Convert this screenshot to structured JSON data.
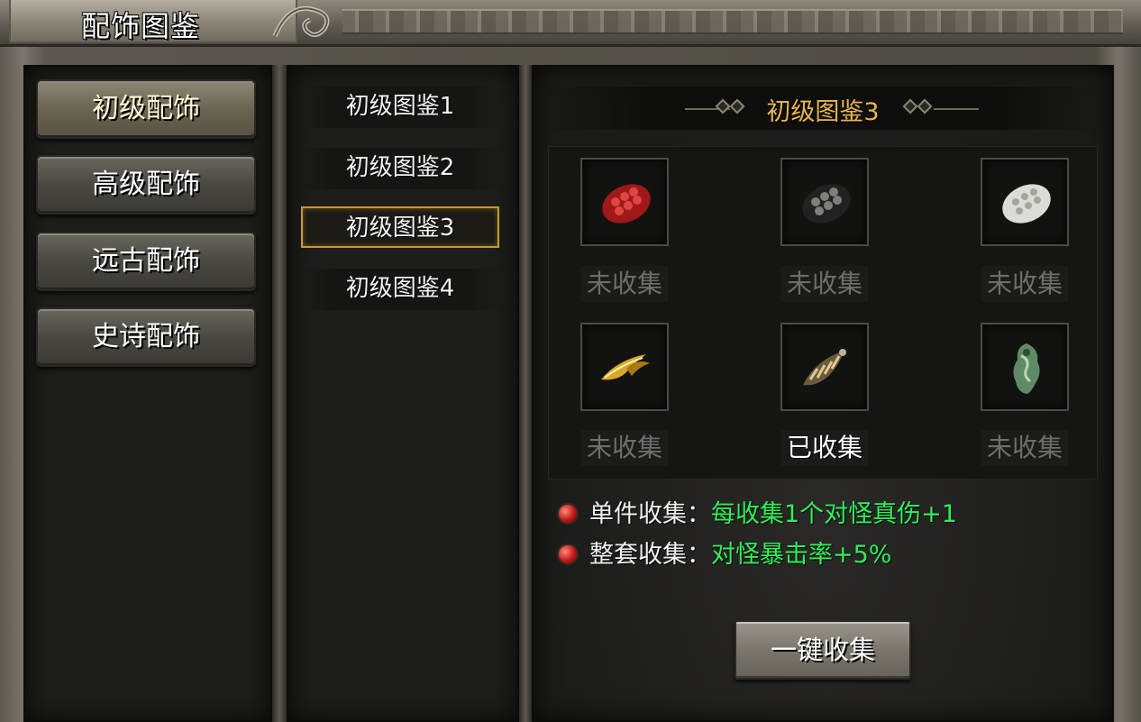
{
  "window": {
    "title": "配饰图鉴"
  },
  "categories": [
    {
      "label": "初级配饰",
      "active": true
    },
    {
      "label": "高级配饰",
      "active": false
    },
    {
      "label": "远古配饰",
      "active": false
    },
    {
      "label": "史诗配饰",
      "active": false
    }
  ],
  "subcategories": [
    {
      "label": "初级图鉴1",
      "selected": false
    },
    {
      "label": "初级图鉴2",
      "selected": false
    },
    {
      "label": "初级图鉴3",
      "selected": true
    },
    {
      "label": "初级图鉴4",
      "selected": false
    }
  ],
  "detail": {
    "title": "初级图鉴3",
    "items": [
      {
        "icon": "red-scale-icon",
        "status": "未收集",
        "collected": false
      },
      {
        "icon": "black-scale-icon",
        "status": "未收集",
        "collected": false
      },
      {
        "icon": "white-scale-icon",
        "status": "未收集",
        "collected": false
      },
      {
        "icon": "golden-claw-icon",
        "status": "未收集",
        "collected": false
      },
      {
        "icon": "striped-claw-icon",
        "status": "已收集",
        "collected": true
      },
      {
        "icon": "jade-pendant-icon",
        "status": "未收集",
        "collected": false
      }
    ],
    "bonuses": [
      {
        "label": "单件收集：",
        "value": "每收集1个对怪真伤+1"
      },
      {
        "label": "整套收集：",
        "value": "对怪暴击率+5%"
      }
    ],
    "collect_button": "一键收集"
  },
  "colors": {
    "accent_gold": "#e9b64a",
    "bonus_green": "#2ff05a",
    "uncollected_gray": "#6e6e6a",
    "selected_border": "#c89a2a"
  }
}
